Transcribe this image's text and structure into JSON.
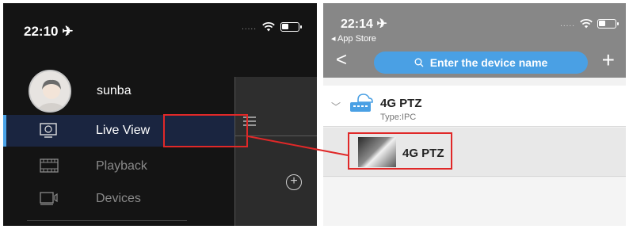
{
  "left_phone": {
    "status": {
      "time": "22:10 ✈︎",
      "signal_dots": "....."
    },
    "user": {
      "name": "sunba"
    },
    "menu": [
      {
        "label": "Live View",
        "icon": "monitor-icon",
        "active": true
      },
      {
        "label": "Playback",
        "icon": "film-icon",
        "active": false
      },
      {
        "label": "Devices",
        "icon": "device-icon",
        "active": false
      }
    ],
    "side_panel": {
      "menu_icon": "hamburger-icon",
      "add_icon": "add-circle-icon"
    }
  },
  "right_phone": {
    "status": {
      "time": "22:14 ✈︎",
      "back_to_app": "◂ App Store",
      "signal_dots": "....."
    },
    "header": {
      "back_label": "<",
      "search_placeholder": "Enter the device name",
      "add_label": "+"
    },
    "device": {
      "name": "4G PTZ",
      "type": "Type:IPC",
      "icon": "camera-device-icon"
    },
    "channel": {
      "name": "4G PTZ",
      "icon": "thumbnail-image"
    }
  },
  "colors": {
    "highlight": "#e02828",
    "active_accent": "#4aa3e8",
    "search_bg": "#4aa0e4"
  }
}
